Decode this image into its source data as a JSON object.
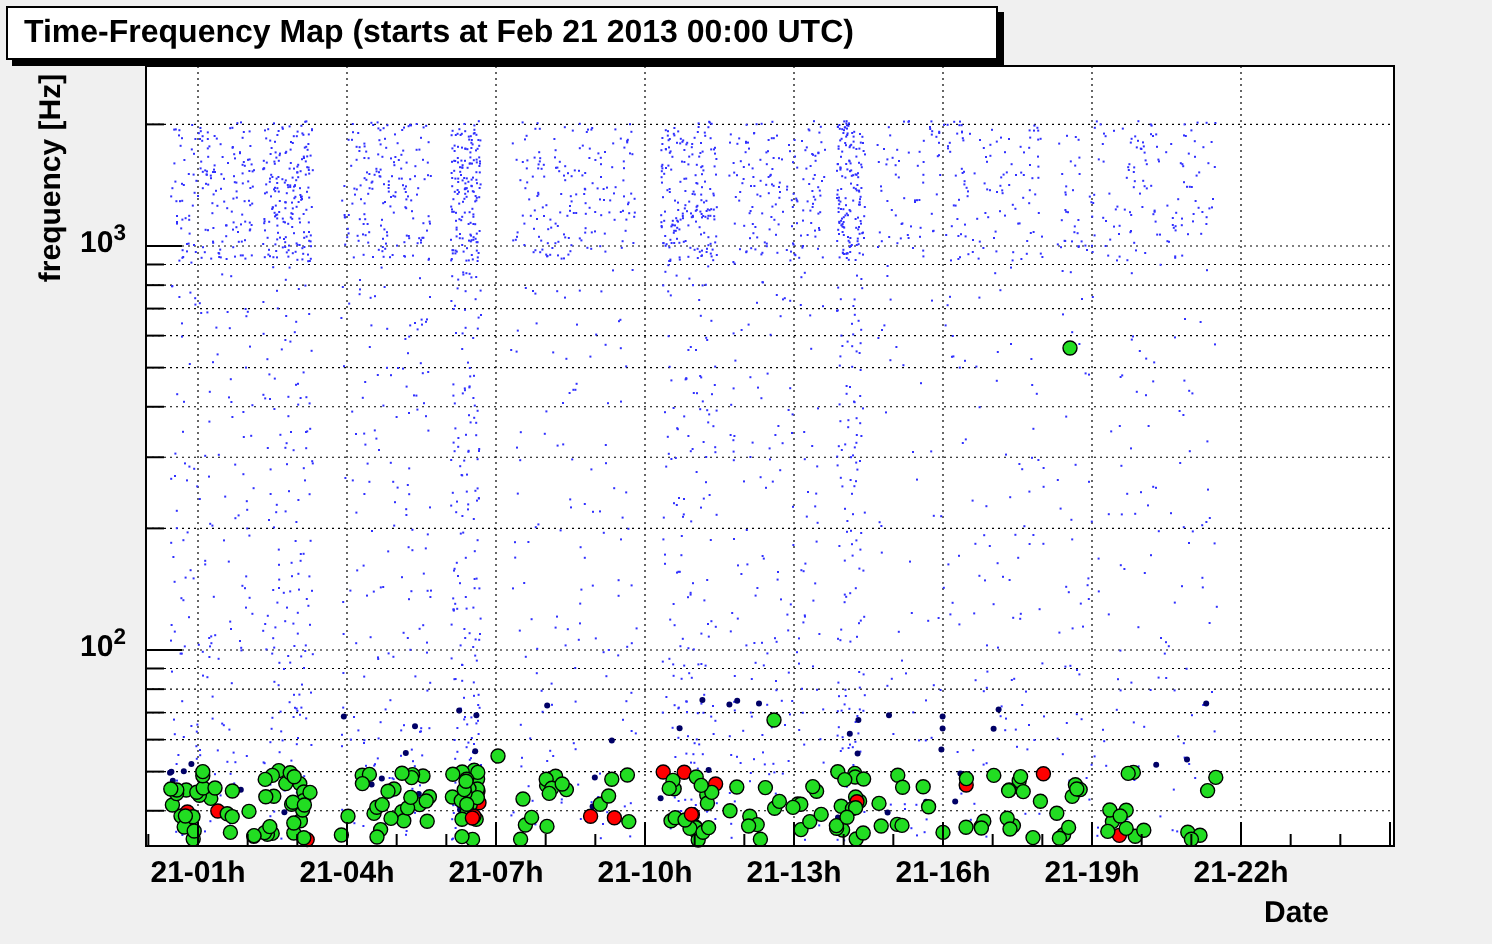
{
  "title": "Time-Frequency Map (starts at Feb 21 2013 00:00 UTC)",
  "y_axis": {
    "label": "frequency [Hz]",
    "ticks": [
      {
        "label": "10$^{3}$",
        "kind": "thousand"
      },
      {
        "label": "10$^{2}$",
        "kind": "hundred"
      }
    ]
  },
  "x_axis": {
    "label": "Date",
    "ticks": [
      "21-01h",
      "21-04h",
      "21-07h",
      "21-10h",
      "21-13h",
      "21-16h",
      "21-19h",
      "21-22h"
    ]
  }
}
